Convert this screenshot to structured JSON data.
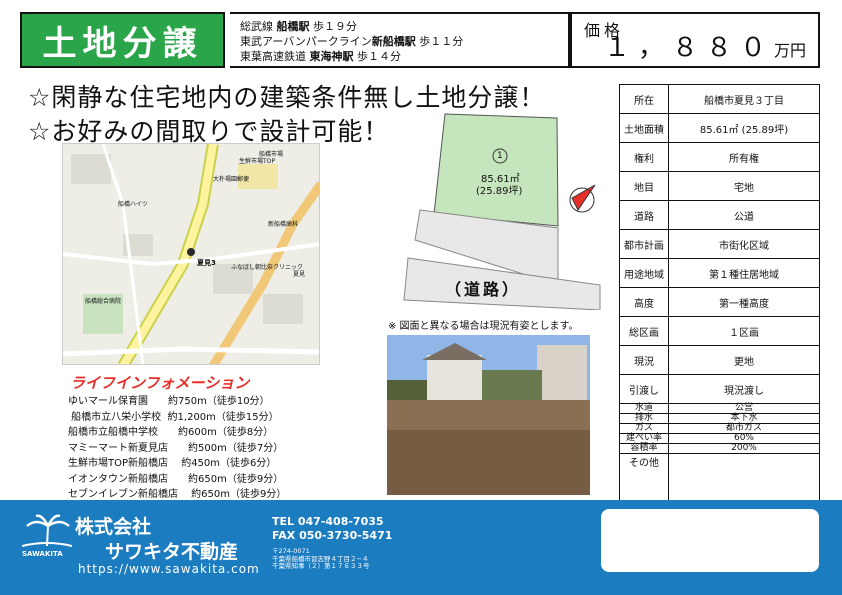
{
  "header": {
    "title": "土地分譲",
    "access": [
      {
        "pre": "総武線 ",
        "station": "船橋駅",
        "post": " 歩１９分"
      },
      {
        "pre": "東武アーバンパークライン",
        "station": "新船橋駅",
        "post": " 歩１１分"
      },
      {
        "pre": "東葉高速鉄道 ",
        "station": "東海神駅",
        "post": " 歩１４分"
      }
    ],
    "price_label": "価格",
    "price_value": "１，８８０",
    "price_unit": "万円"
  },
  "headlines": [
    "☆閑静な住宅地内の建築条件無し土地分譲！",
    "☆お好みの間取りで設計可能！"
  ],
  "map": {
    "labels": [
      "生鮮市場TOP",
      "大朴場園郵便",
      "新船橋歯科",
      "夏見3",
      "ふなばし朝比奈クリニック",
      "船橋総合病院",
      "船橋ハイツ",
      "夏見",
      "船橋市場"
    ]
  },
  "plot": {
    "lot_number": "1",
    "area_sqm": "85.61㎡",
    "area_tsubo": "(25.89坪)",
    "road_label": "（道路）",
    "note": "※ 図面と異なる場合は現況有姿とします。"
  },
  "property": {
    "rows": [
      {
        "k": "所在",
        "v": "船橋市夏見３丁目"
      },
      {
        "k": "土地面積",
        "v": "85.61㎡ (25.89坪)"
      },
      {
        "k": "権利",
        "v": "所有権"
      },
      {
        "k": "地目",
        "v": "宅地"
      },
      {
        "k": "道路",
        "v": "公道"
      },
      {
        "k": "都市計画",
        "v": "市街化区域"
      },
      {
        "k": "用途地域",
        "v": "第１種住居地域"
      },
      {
        "k": "高度",
        "v": "第一種高度"
      },
      {
        "k": "総区画",
        "v": "１区画"
      },
      {
        "k": "現況",
        "v": "更地"
      },
      {
        "k": "引渡し",
        "v": "現況渡し"
      }
    ],
    "small_rows": [
      {
        "k": "水道",
        "v": "公営"
      },
      {
        "k": "排水",
        "v": "本下水"
      },
      {
        "k": "ガス",
        "v": "都市ガス"
      },
      {
        "k": "建ぺい率",
        "v": "60%"
      },
      {
        "k": "容積率",
        "v": "200%"
      }
    ],
    "other_label": "その他"
  },
  "lifeline": {
    "title": "ライフインフォメーション",
    "items": [
      "ゆいマール保育園　　約750m（徒歩10分）",
      " 船橋市立八栄小学校  約1,200m（徒歩15分）",
      "船橋市立船橋中学校　　約600m（徒歩8分）",
      "マミーマート新夏見店　　約500m（徒歩7分）",
      "生鮮市場TOP新船橋店　 約450m（徒歩6分）",
      "イオンタウン新船橋店　　約650m（徒歩9分）",
      "セブンイレブン新船橋店　 約650m（徒歩9分）"
    ]
  },
  "footer": {
    "logo_text": "SAWAKITA",
    "company_line1": "株式会社",
    "company_line2": "サワキタ不動産",
    "url": "https://www.sawakita.com",
    "tel": "TEL  047-408-7035",
    "fax": "FAX  050-3730-5471",
    "address": [
      "〒274-0071",
      "千葉県船橋市習志野４丁目２−４",
      "千葉県知事（２）第１７６３３号"
    ]
  },
  "colors": {
    "green": "#2aa54a",
    "blue": "#1c7cc0",
    "red": "#e8302a"
  }
}
